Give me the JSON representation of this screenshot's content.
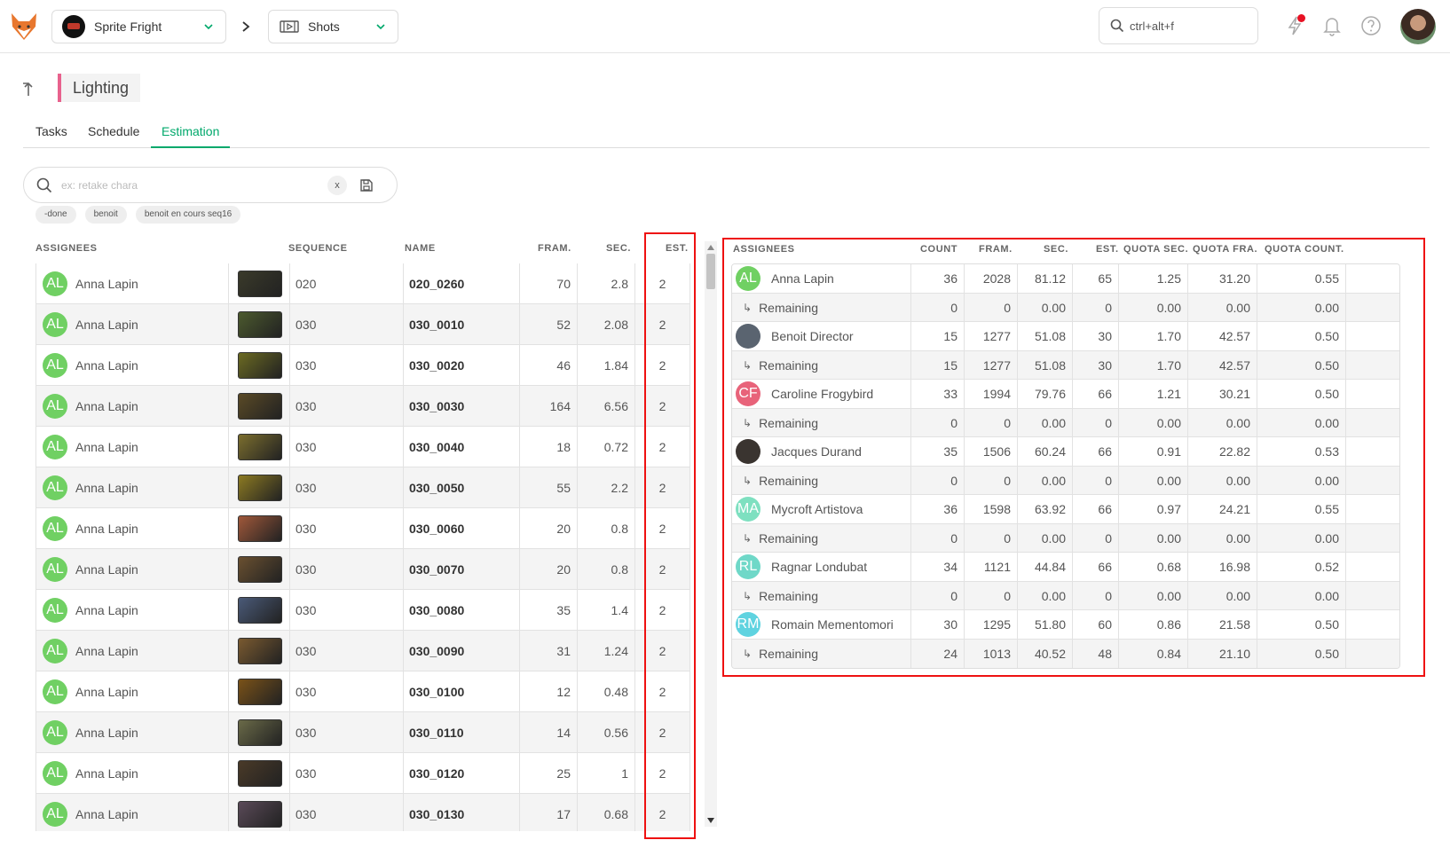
{
  "topbar": {
    "production": "Sprite Fright",
    "section": "Shots",
    "search_placeholder": "ctrl+alt+f"
  },
  "header": {
    "title": "Lighting",
    "tabs": [
      "Tasks",
      "Schedule",
      "Estimation"
    ],
    "active_tab": "Estimation"
  },
  "search": {
    "placeholder": "ex: retake chara",
    "clear_label": "x",
    "filters": [
      "-done",
      "benoit",
      "benoit en cours seq16"
    ]
  },
  "left_table": {
    "headers": {
      "assignees": "ASSIGNEES",
      "sequence": "SEQUENCE",
      "name": "NAME",
      "fram": "FRAM.",
      "sec": "SEC.",
      "est": "EST."
    },
    "rows": [
      {
        "initials": "AL",
        "assignee": "Anna Lapin",
        "sequence": "020",
        "name": "020_0260",
        "fram": "70",
        "sec": "2.8",
        "est": "2",
        "thumb_color": "#3a3a2a"
      },
      {
        "initials": "AL",
        "assignee": "Anna Lapin",
        "sequence": "030",
        "name": "030_0010",
        "fram": "52",
        "sec": "2.08",
        "est": "2",
        "thumb_color": "#4c5a2e"
      },
      {
        "initials": "AL",
        "assignee": "Anna Lapin",
        "sequence": "030",
        "name": "030_0020",
        "fram": "46",
        "sec": "1.84",
        "est": "2",
        "thumb_color": "#6b6a22"
      },
      {
        "initials": "AL",
        "assignee": "Anna Lapin",
        "sequence": "030",
        "name": "030_0030",
        "fram": "164",
        "sec": "6.56",
        "est": "2",
        "thumb_color": "#5a4a26"
      },
      {
        "initials": "AL",
        "assignee": "Anna Lapin",
        "sequence": "030",
        "name": "030_0040",
        "fram": "18",
        "sec": "0.72",
        "est": "2",
        "thumb_color": "#7b6e2e"
      },
      {
        "initials": "AL",
        "assignee": "Anna Lapin",
        "sequence": "030",
        "name": "030_0050",
        "fram": "55",
        "sec": "2.2",
        "est": "2",
        "thumb_color": "#8c7a22"
      },
      {
        "initials": "AL",
        "assignee": "Anna Lapin",
        "sequence": "030",
        "name": "030_0060",
        "fram": "20",
        "sec": "0.8",
        "est": "2",
        "thumb_color": "#a0583a"
      },
      {
        "initials": "AL",
        "assignee": "Anna Lapin",
        "sequence": "030",
        "name": "030_0070",
        "fram": "20",
        "sec": "0.8",
        "est": "2",
        "thumb_color": "#6a5030"
      },
      {
        "initials": "AL",
        "assignee": "Anna Lapin",
        "sequence": "030",
        "name": "030_0080",
        "fram": "35",
        "sec": "1.4",
        "est": "2",
        "thumb_color": "#4a5a78"
      },
      {
        "initials": "AL",
        "assignee": "Anna Lapin",
        "sequence": "030",
        "name": "030_0090",
        "fram": "31",
        "sec": "1.24",
        "est": "2",
        "thumb_color": "#7a5a30"
      },
      {
        "initials": "AL",
        "assignee": "Anna Lapin",
        "sequence": "030",
        "name": "030_0100",
        "fram": "12",
        "sec": "0.48",
        "est": "2",
        "thumb_color": "#7a5218"
      },
      {
        "initials": "AL",
        "assignee": "Anna Lapin",
        "sequence": "030",
        "name": "030_0110",
        "fram": "14",
        "sec": "0.56",
        "est": "2",
        "thumb_color": "#6a6a48"
      },
      {
        "initials": "AL",
        "assignee": "Anna Lapin",
        "sequence": "030",
        "name": "030_0120",
        "fram": "25",
        "sec": "1",
        "est": "2",
        "thumb_color": "#4a3a28"
      },
      {
        "initials": "AL",
        "assignee": "Anna Lapin",
        "sequence": "030",
        "name": "030_0130",
        "fram": "17",
        "sec": "0.68",
        "est": "2",
        "thumb_color": "#5a4a58"
      }
    ]
  },
  "right_table": {
    "headers": {
      "assignees": "ASSIGNEES",
      "count": "COUNT",
      "fram": "FRAM.",
      "sec": "SEC.",
      "est": "EST.",
      "quota_sec": "QUOTA SEC.",
      "quota_fra": "QUOTA FRA.",
      "quota_count": "QUOTA COUNT."
    },
    "remaining_label": "Remaining",
    "people": [
      {
        "name": "Anna Lapin",
        "initials": "AL",
        "avatar_color": "#70d063",
        "main": {
          "count": "36",
          "fram": "2028",
          "sec": "81.12",
          "est": "65",
          "quota_sec": "1.25",
          "quota_fra": "31.20",
          "quota_count": "0.55"
        },
        "remaining": {
          "count": "0",
          "fram": "0",
          "sec": "0.00",
          "est": "0",
          "quota_sec": "0.00",
          "quota_fra": "0.00",
          "quota_count": "0.00"
        }
      },
      {
        "name": "Benoit Director",
        "initials": "",
        "avatar_color": "#5a6470",
        "main": {
          "count": "15",
          "fram": "1277",
          "sec": "51.08",
          "est": "30",
          "quota_sec": "1.70",
          "quota_fra": "42.57",
          "quota_count": "0.50"
        },
        "remaining": {
          "count": "15",
          "fram": "1277",
          "sec": "51.08",
          "est": "30",
          "quota_sec": "1.70",
          "quota_fra": "42.57",
          "quota_count": "0.50"
        }
      },
      {
        "name": "Caroline Frogybird",
        "initials": "CF",
        "avatar_color": "#e8637a",
        "main": {
          "count": "33",
          "fram": "1994",
          "sec": "79.76",
          "est": "66",
          "quota_sec": "1.21",
          "quota_fra": "30.21",
          "quota_count": "0.50"
        },
        "remaining": {
          "count": "0",
          "fram": "0",
          "sec": "0.00",
          "est": "0",
          "quota_sec": "0.00",
          "quota_fra": "0.00",
          "quota_count": "0.00"
        }
      },
      {
        "name": "Jacques Durand",
        "initials": "",
        "avatar_color": "#3a3430",
        "main": {
          "count": "35",
          "fram": "1506",
          "sec": "60.24",
          "est": "66",
          "quota_sec": "0.91",
          "quota_fra": "22.82",
          "quota_count": "0.53"
        },
        "remaining": {
          "count": "0",
          "fram": "0",
          "sec": "0.00",
          "est": "0",
          "quota_sec": "0.00",
          "quota_fra": "0.00",
          "quota_count": "0.00"
        }
      },
      {
        "name": "Mycroft Artistova",
        "initials": "MA",
        "avatar_color": "#7ee0c0",
        "main": {
          "count": "36",
          "fram": "1598",
          "sec": "63.92",
          "est": "66",
          "quota_sec": "0.97",
          "quota_fra": "24.21",
          "quota_count": "0.55"
        },
        "remaining": {
          "count": "0",
          "fram": "0",
          "sec": "0.00",
          "est": "0",
          "quota_sec": "0.00",
          "quota_fra": "0.00",
          "quota_count": "0.00"
        }
      },
      {
        "name": "Ragnar Londubat",
        "initials": "RL",
        "avatar_color": "#6fd8c8",
        "main": {
          "count": "34",
          "fram": "1121",
          "sec": "44.84",
          "est": "66",
          "quota_sec": "0.68",
          "quota_fra": "16.98",
          "quota_count": "0.52"
        },
        "remaining": {
          "count": "0",
          "fram": "0",
          "sec": "0.00",
          "est": "0",
          "quota_sec": "0.00",
          "quota_fra": "0.00",
          "quota_count": "0.00"
        }
      },
      {
        "name": "Romain Mementomori",
        "initials": "RM",
        "avatar_color": "#5fd3e0",
        "main": {
          "count": "30",
          "fram": "1295",
          "sec": "51.80",
          "est": "60",
          "quota_sec": "0.86",
          "quota_fra": "21.58",
          "quota_count": "0.50"
        },
        "remaining": {
          "count": "24",
          "fram": "1013",
          "sec": "40.52",
          "est": "48",
          "quota_sec": "0.84",
          "quota_fra": "21.10",
          "quota_count": "0.50"
        }
      }
    ]
  },
  "colors": {
    "accent_green": "#00a86b",
    "title_bar": "#e8628d",
    "highlight_red": "#e11111"
  }
}
